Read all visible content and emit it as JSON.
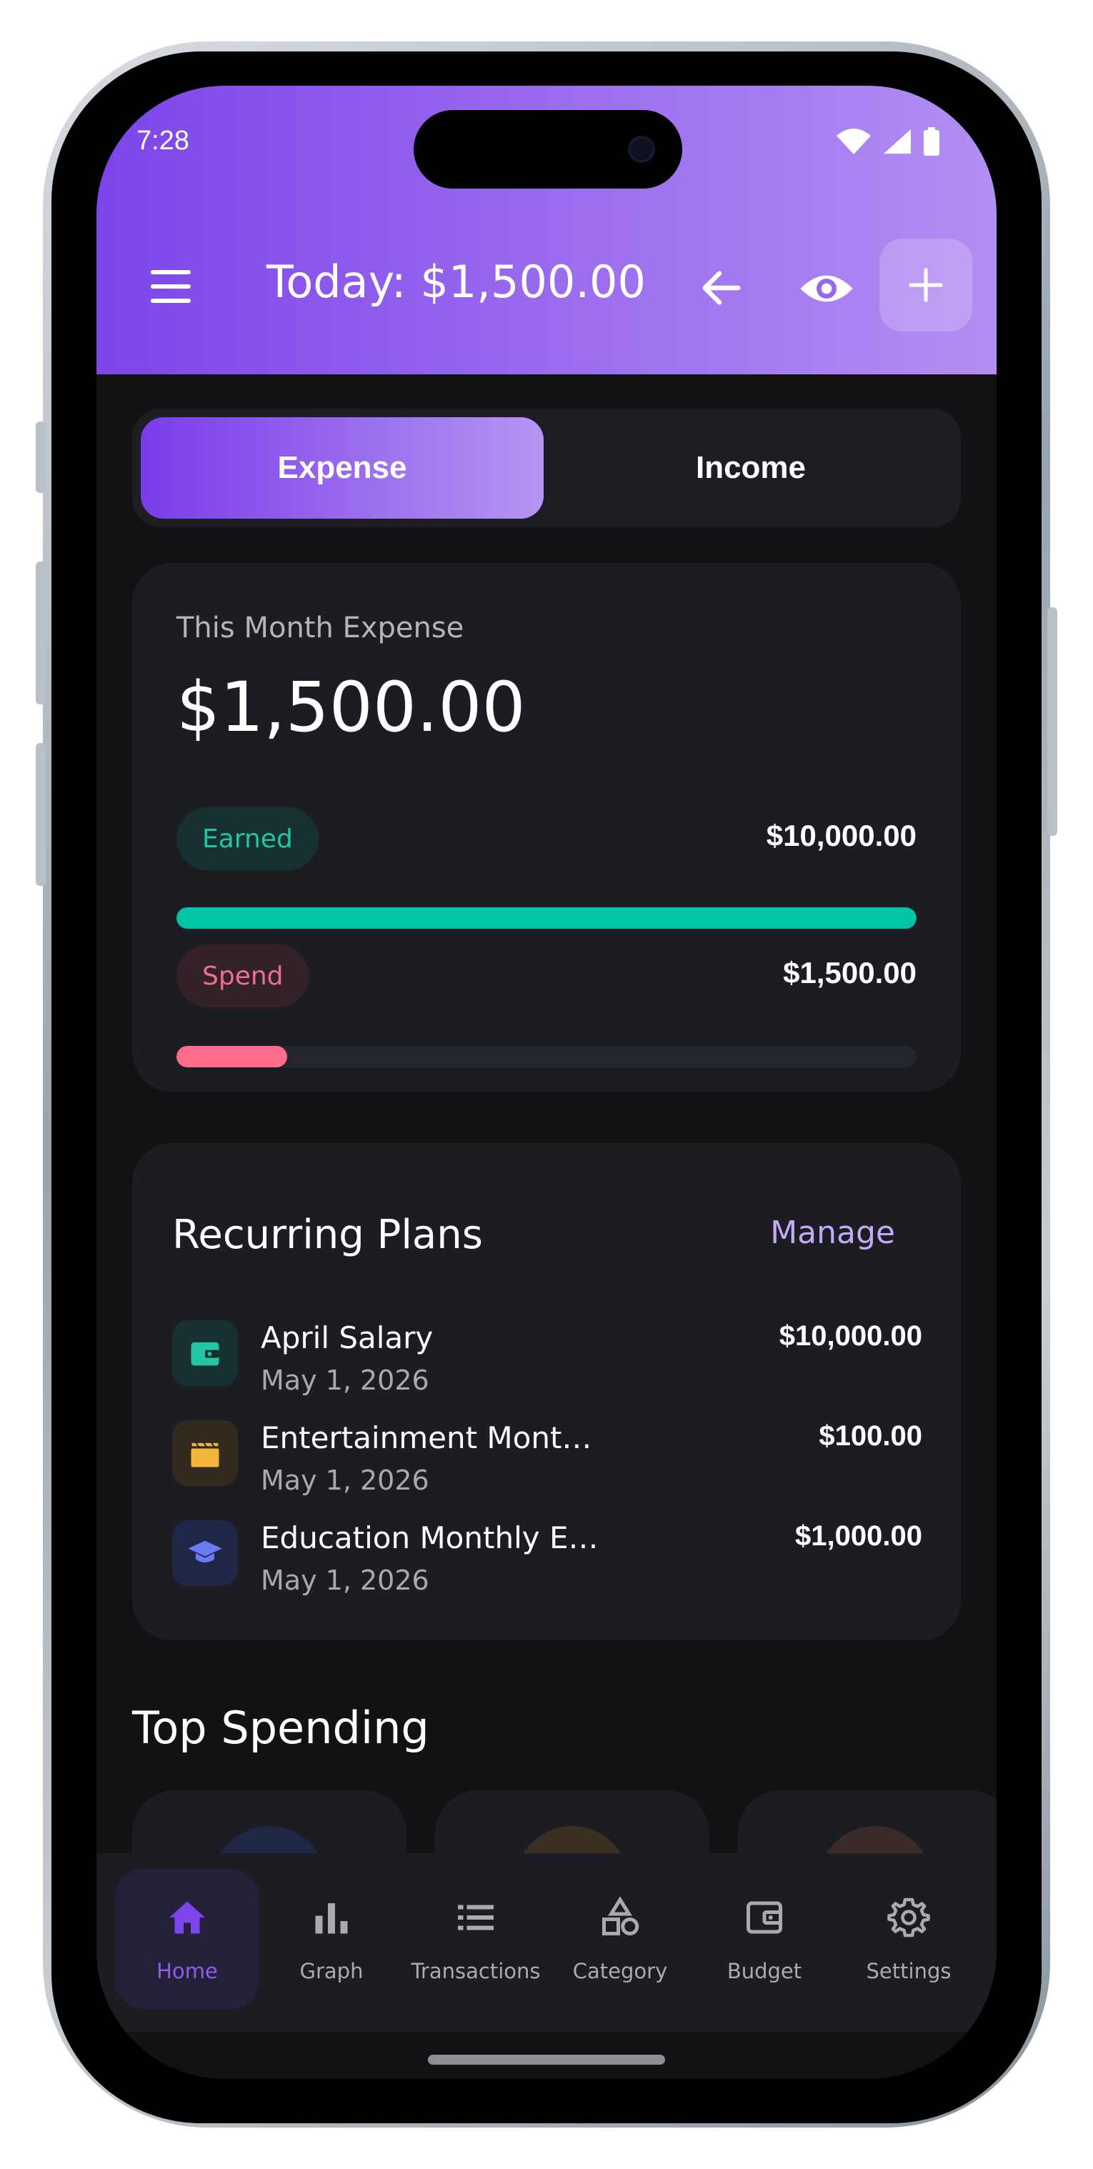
{
  "status_bar": {
    "time": "7:28"
  },
  "header": {
    "title": "Today: $1,500.00"
  },
  "segment": {
    "expense_label": "Expense",
    "income_label": "Income",
    "selected": "Expense"
  },
  "summary": {
    "label": "This Month Expense",
    "value": "$1,500.00",
    "earned": {
      "label": "Earned",
      "amount": "$10,000.00",
      "fraction": 1.0,
      "color": "#00c4a7"
    },
    "spend": {
      "label": "Spend",
      "amount": "$1,500.00",
      "fraction": 0.15,
      "color": "#ff6b8b"
    }
  },
  "recurring_plans": {
    "title": "Recurring Plans",
    "manage_label": "Manage",
    "items": [
      {
        "name": "April Salary",
        "date": "May 1, 2026",
        "amount": "$10,000.00",
        "icon": "wallet-icon",
        "icon_color": "#22c6a6",
        "icon_bg": "#173130"
      },
      {
        "name": "Entertainment Mont…",
        "date": "May 1, 2026",
        "amount": "$100.00",
        "icon": "clapperboard-icon",
        "icon_color": "#f4b63a",
        "icon_bg": "#322a1d"
      },
      {
        "name": "Education Monthly E…",
        "date": "May 1, 2026",
        "amount": "$1,000.00",
        "icon": "graduation-cap-icon",
        "icon_color": "#6a7cf2",
        "icon_bg": "#202645"
      }
    ]
  },
  "top_spending": {
    "title": "Top Spending"
  },
  "bottom_nav": {
    "items": [
      {
        "label": "Home",
        "icon": "home-icon",
        "active": true
      },
      {
        "label": "Graph",
        "icon": "bar-chart-icon",
        "active": false
      },
      {
        "label": "Transactions",
        "icon": "list-icon",
        "active": false
      },
      {
        "label": "Category",
        "icon": "shapes-icon",
        "active": false
      },
      {
        "label": "Budget",
        "icon": "wallet-icon",
        "active": false
      },
      {
        "label": "Settings",
        "icon": "gear-icon",
        "active": false
      }
    ]
  },
  "colors": {
    "accent": "#7c45ea",
    "background": "#121214",
    "card": "#1b1d23"
  }
}
